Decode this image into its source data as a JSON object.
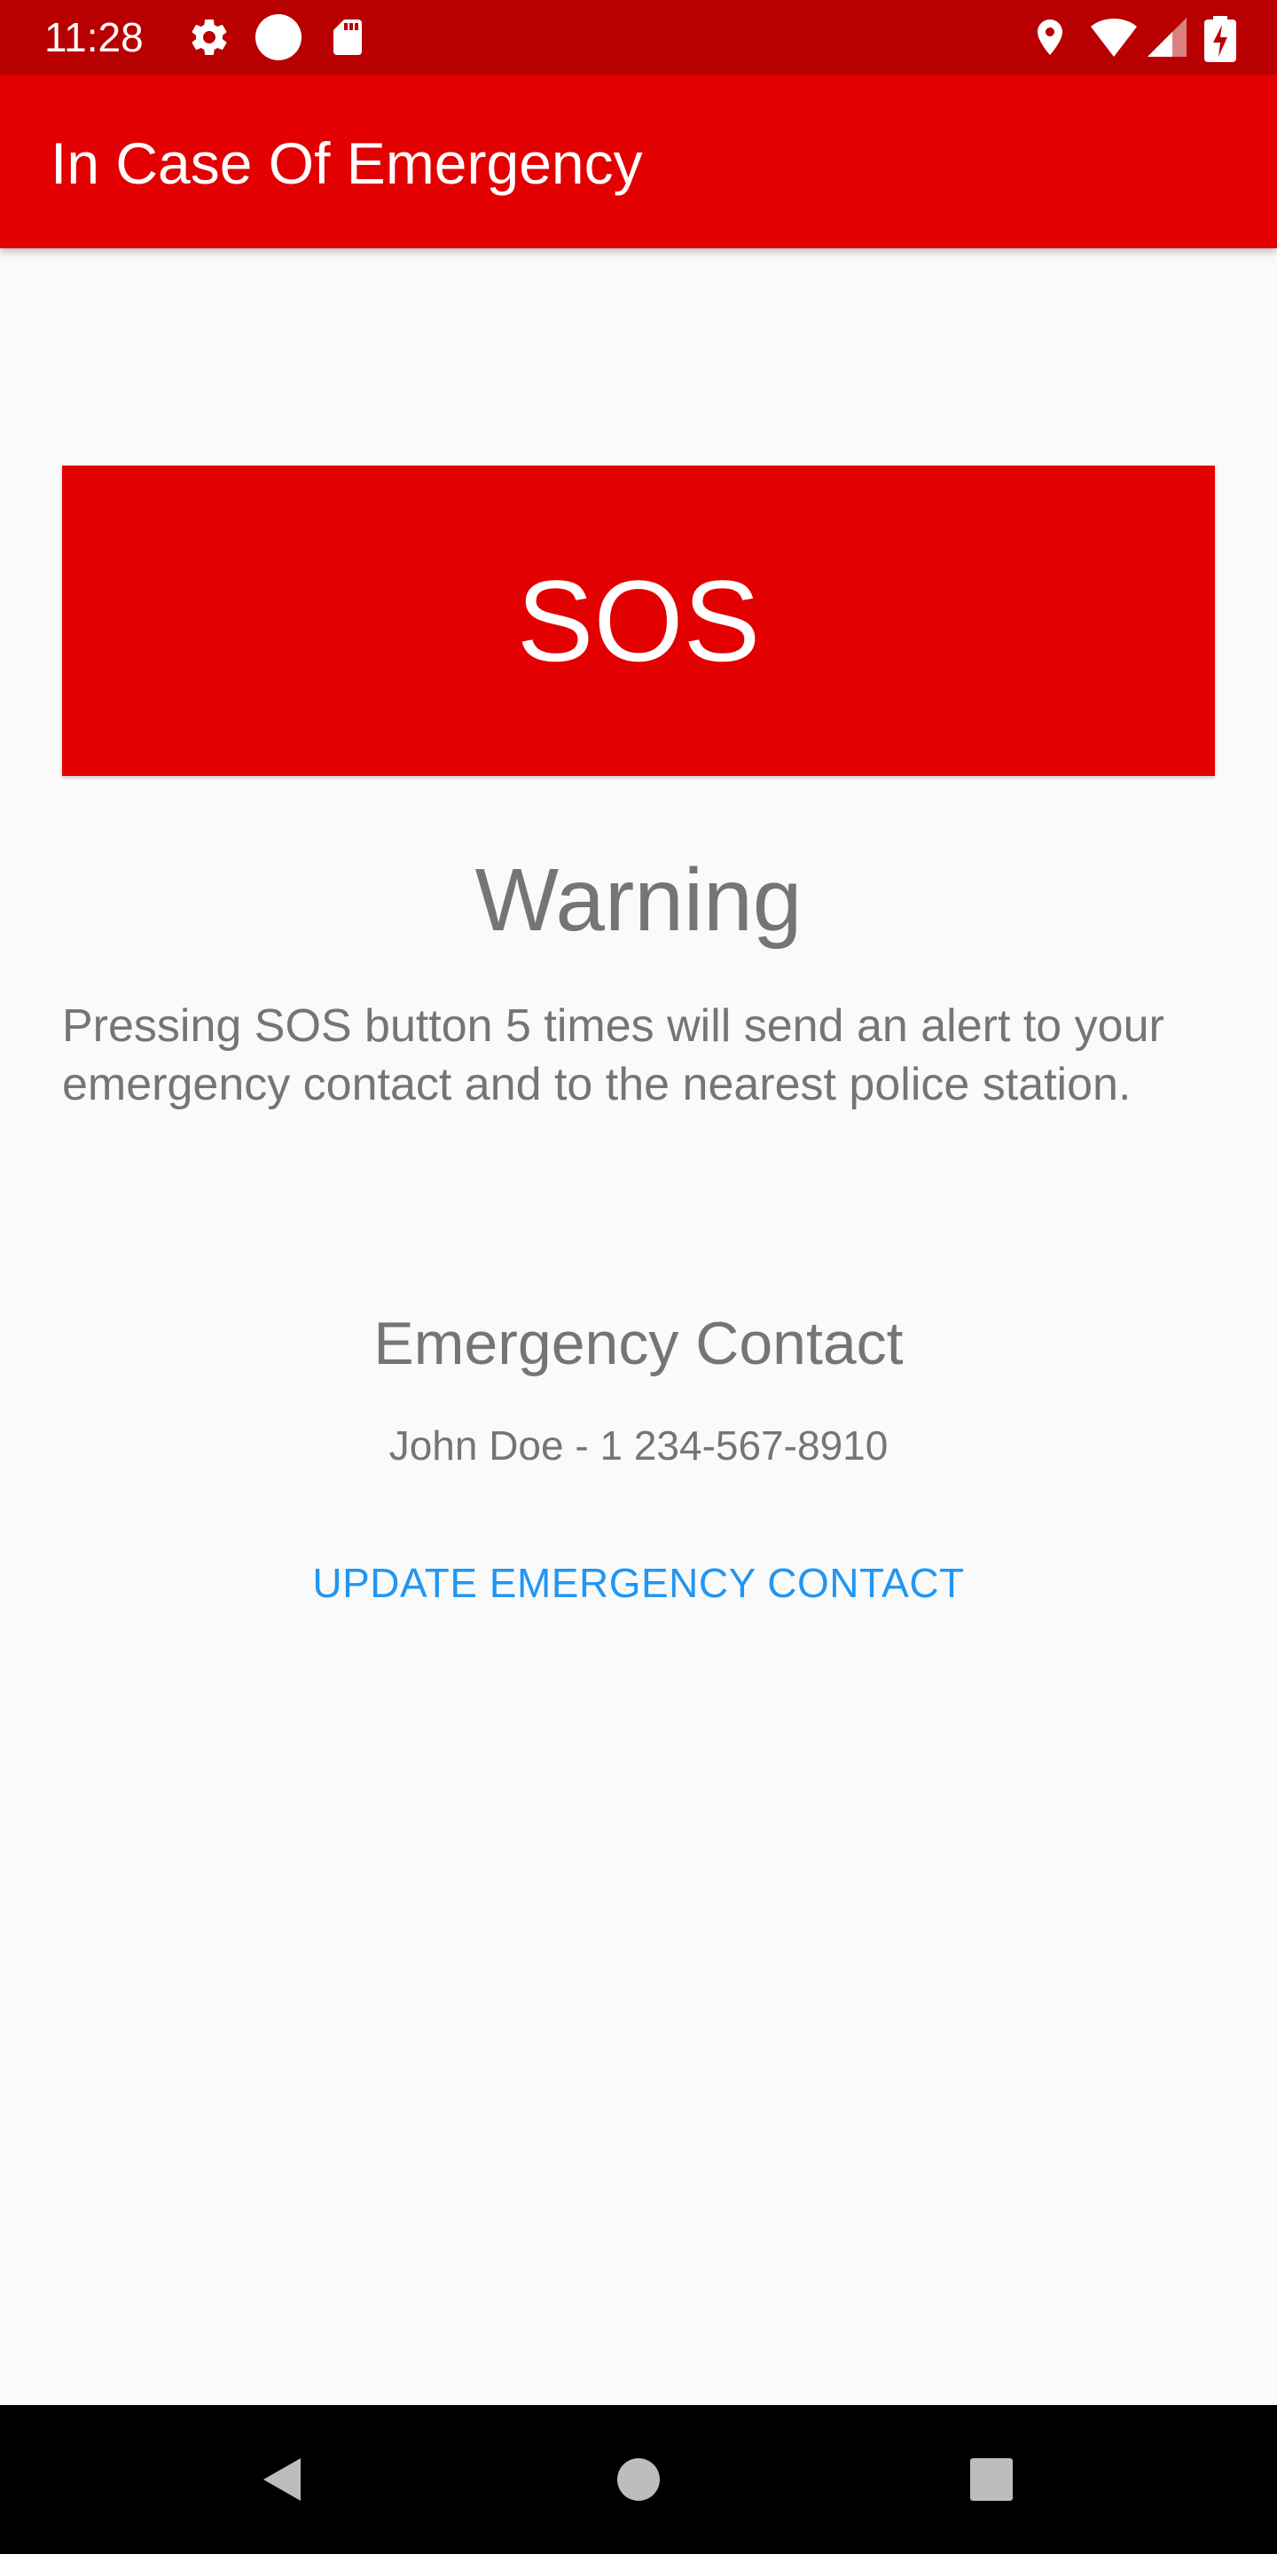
{
  "status_bar": {
    "time": "11:28",
    "icons": [
      "gear-icon",
      "circle-icon",
      "sd-card-icon",
      "location-icon",
      "wifi-icon",
      "signal-icon",
      "battery-icon"
    ],
    "background": "#b80000"
  },
  "app_bar": {
    "title": "In Case Of Emergency",
    "background": "#e20000"
  },
  "sos_button": {
    "label": "SOS",
    "background": "#e20000"
  },
  "warning": {
    "title": "Warning",
    "text": "Pressing SOS button 5 times will send an alert to your emergency contact and to the nearest police station."
  },
  "emergency_contact": {
    "heading": "Emergency Contact",
    "value": "John Doe - 1 234-567-8910",
    "update_label": "UPDATE EMERGENCY CONTACT",
    "accent": "#2196f3"
  },
  "nav_bar": {
    "icons": [
      "back-icon",
      "home-icon",
      "recents-icon"
    ]
  }
}
